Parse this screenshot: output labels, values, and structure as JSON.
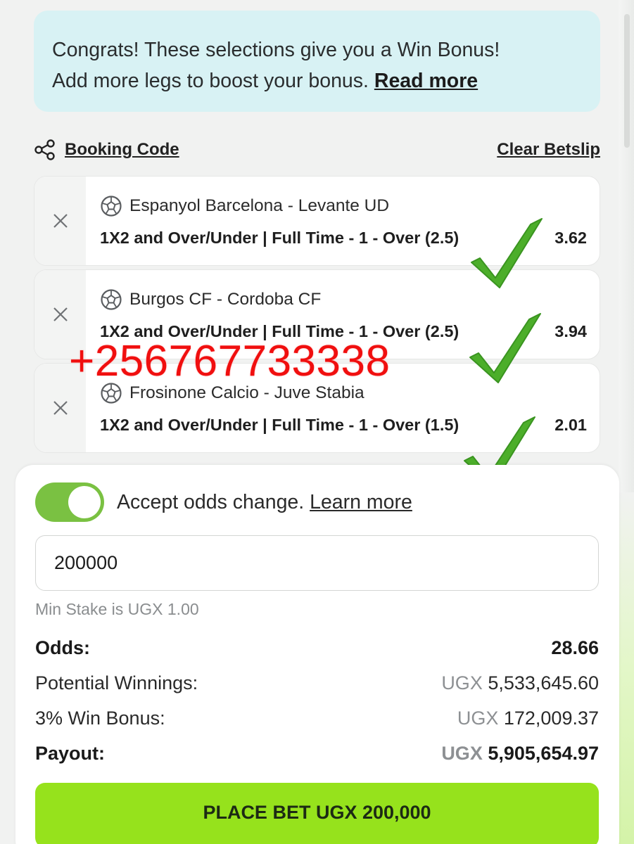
{
  "banner": {
    "line1": "Congrats! These selections give you a Win Bonus!",
    "line2": "Add more legs to boost your bonus.",
    "read_more": "Read more"
  },
  "actions": {
    "booking_code": "Booking Code",
    "clear_betslip": "Clear Betslip"
  },
  "legs": [
    {
      "match": "Espanyol Barcelona - Levante UD",
      "market": "1X2 and Over/Under | Full Time - 1 - Over (2.5)",
      "odds": "3.62"
    },
    {
      "match": "Burgos CF - Cordoba CF",
      "market": "1X2 and Over/Under | Full Time - 1 - Over (2.5)",
      "odds": "3.94"
    },
    {
      "match": "Frosinone Calcio - Juve Stabia",
      "market": "1X2 and Over/Under | Full Time - 1 - Over (1.5)",
      "odds": "2.01"
    }
  ],
  "overlay": {
    "phone": "+256767733338",
    "check_color": "#4cae2a"
  },
  "summary": {
    "accept_odds_change": "Accept odds change.",
    "learn_more": "Learn more",
    "accept_toggle_on": true,
    "stake_value": "200000",
    "min_stake": "Min Stake is UGX 1.00",
    "odds_label": "Odds:",
    "odds_value": "28.66",
    "potential_label": "Potential Winnings:",
    "potential_currency": "UGX",
    "potential_value": "5,533,645.60",
    "bonus_label": "3% Win Bonus:",
    "bonus_currency": "UGX",
    "bonus_value": "172,009.37",
    "payout_label": "Payout:",
    "payout_currency": "UGX",
    "payout_value": "5,905,654.97",
    "place_bet": "PLACE BET UGX 200,000"
  },
  "colors": {
    "accent_green": "#96e21c",
    "toggle_green": "#7ac142",
    "banner_bg": "#d8f2f4",
    "overlay_red": "#f00f0f"
  },
  "icons": [
    "share-icon",
    "close-icon",
    "soccer-ball-icon",
    "checkmark-icon"
  ]
}
